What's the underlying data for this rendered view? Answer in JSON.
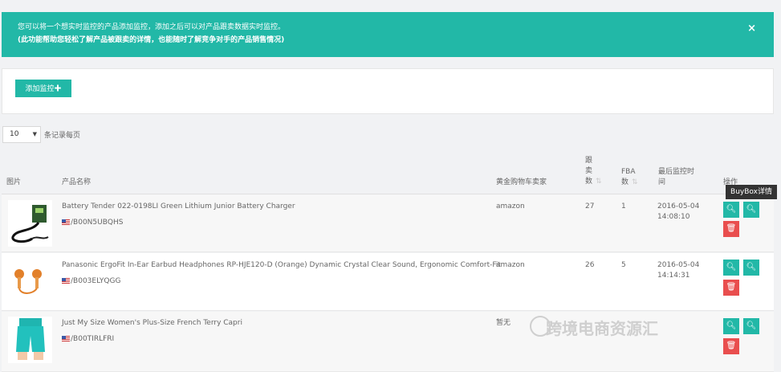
{
  "alert": {
    "line1": "您可以将一个想实时监控的产品添加监控，添加之后可以对产品跟卖数据实时监控。",
    "line2": "(此功能帮助您轻松了解产品被跟卖的详情，也能随时了解竞争对手的产品销售情况)",
    "close": "×"
  },
  "toolbar": {
    "add_label": "添加监控✚"
  },
  "pagination": {
    "page_size": "10",
    "page_size_label": "条记录每页"
  },
  "table": {
    "headers": {
      "image": "图片",
      "name": "产品名称",
      "buybox_seller": "黄金购物车卖家",
      "follow_count": [
        "跟",
        "卖",
        "数"
      ],
      "fba_count": [
        "FBA",
        "数"
      ],
      "last_time": [
        "最后监控时",
        "间"
      ],
      "actions": "操作"
    },
    "rows": [
      {
        "name": "Battery Tender 022-0198LI Green Lithium Junior Battery Charger",
        "asin": "B00N5UBQHS",
        "seller": "amazon",
        "follow": "27",
        "fba": "1",
        "date": "2016-05-04",
        "time": "14:08:10"
      },
      {
        "name": "Panasonic ErgoFit In-Ear Earbud Headphones RP-HJE120-D (Orange) Dynamic Crystal Clear Sound, Ergonomic Comfort-Fit",
        "asin": "B003ELYQGG",
        "seller": "amazon",
        "follow": "26",
        "fba": "5",
        "date": "2016-05-04",
        "time": "14:14:31"
      },
      {
        "name": "Just My Size Women's Plus-Size French Terry Capri",
        "asin": "B00TIRLFRI",
        "seller": "暂无",
        "follow": "",
        "fba": "",
        "date": "",
        "time": ""
      }
    ]
  },
  "tooltip": "BuyBox详情",
  "watermark": "跨境电商资源汇",
  "icons": {
    "search": "search-icon",
    "delete": "trash-icon",
    "sort": "sort-icon",
    "flag": "us-flag-icon"
  },
  "colors": {
    "accent": "#22b8a7",
    "danger": "#e94e4e"
  }
}
